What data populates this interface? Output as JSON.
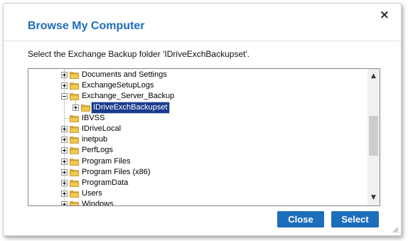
{
  "dialog": {
    "title": "Browse My Computer",
    "close_glyph": "×",
    "instruction": "Select the Exchange Backup folder 'IDriveExchBackupset'."
  },
  "tree": {
    "items": [
      {
        "label": "Documents and Settings",
        "expander": "plus",
        "selected": false
      },
      {
        "label": "ExchangeSetupLogs",
        "expander": "plus",
        "selected": false
      },
      {
        "label": "Exchange_Server_Backup",
        "expander": "minus",
        "selected": false
      },
      {
        "label": "IDriveExchBackupset",
        "expander": "plus",
        "selected": true
      },
      {
        "label": "IBVSS",
        "expander": "none",
        "selected": false
      },
      {
        "label": "IDriveLocal",
        "expander": "plus",
        "selected": false
      },
      {
        "label": "inetpub",
        "expander": "plus",
        "selected": false
      },
      {
        "label": "PerfLogs",
        "expander": "plus",
        "selected": false
      },
      {
        "label": "Program Files",
        "expander": "plus",
        "selected": false
      },
      {
        "label": "Program Files (x86)",
        "expander": "plus",
        "selected": false
      },
      {
        "label": "ProgramData",
        "expander": "plus",
        "selected": false
      },
      {
        "label": "Users",
        "expander": "plus",
        "selected": false
      },
      {
        "label": "Windows",
        "expander": "plus",
        "selected": false
      }
    ]
  },
  "scrollbar": {
    "up_glyph": "▲",
    "down_glyph": "▼"
  },
  "buttons": {
    "close_label": "Close",
    "select_label": "Select"
  },
  "colors": {
    "accent": "#1c6ebc",
    "selection": "#1a3b8e",
    "folder": "#f2c94c"
  },
  "icons": {
    "folder": "folder-icon",
    "expand": "expand-icon",
    "collapse": "collapse-icon"
  }
}
